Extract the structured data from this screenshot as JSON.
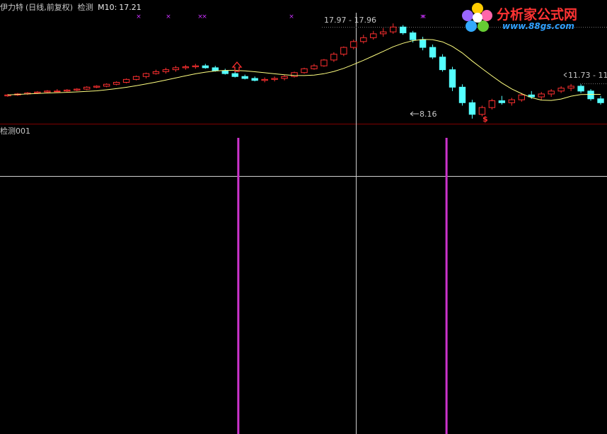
{
  "header": {
    "stock_name": "伊力特",
    "period": "(日线,前复权)",
    "indicator": "检测",
    "ma_label": "M10:",
    "ma_value": "17.21"
  },
  "logo": {
    "name": "分析家公式网",
    "url": "www.88gs.com"
  },
  "annotations": {
    "high_price_label": "17.97 - 17.96",
    "low_price_label": "8.16",
    "right_price_label": "11.73 - 11",
    "signal_marker": "$"
  },
  "sub_panel": {
    "label": "检测001"
  },
  "colors": {
    "up_candle": "#ff3030",
    "down_candle": "#54ffff",
    "ma_line": "#ffff80",
    "signal_bar": "#cc33cc",
    "cross_marker": "#cc33ff",
    "arrow_marker": "#ff3030",
    "crosshair": "#d0d0d0",
    "divider": "#800000"
  },
  "chart_data": {
    "type": "candlestick",
    "series": [
      {
        "values": [
          [
            10.5,
            10.7,
            10.4,
            10.6
          ],
          [
            10.6,
            10.8,
            10.5,
            10.7
          ],
          [
            10.7,
            10.9,
            10.6,
            10.8
          ],
          [
            10.8,
            11.0,
            10.7,
            10.9
          ],
          [
            10.9,
            11.1,
            10.8,
            11.0
          ],
          [
            11.0,
            11.2,
            10.9,
            11.0
          ],
          [
            11.0,
            11.2,
            10.9,
            11.1
          ],
          [
            11.1,
            11.3,
            11.0,
            11.2
          ],
          [
            11.2,
            11.5,
            11.1,
            11.4
          ],
          [
            11.4,
            11.6,
            11.3,
            11.5
          ],
          [
            11.5,
            11.8,
            11.4,
            11.7
          ],
          [
            11.7,
            12.0,
            11.6,
            11.9
          ],
          [
            11.9,
            12.3,
            11.8,
            12.2
          ],
          [
            12.2,
            12.6,
            12.1,
            12.5
          ],
          [
            12.5,
            12.9,
            12.3,
            12.8
          ],
          [
            12.8,
            13.2,
            12.7,
            13.0
          ],
          [
            13.0,
            13.4,
            12.8,
            13.2
          ],
          [
            13.2,
            13.6,
            13.0,
            13.4
          ],
          [
            13.4,
            13.7,
            13.2,
            13.5
          ],
          [
            13.5,
            13.8,
            13.3,
            13.6
          ],
          [
            13.6,
            13.8,
            13.3,
            13.4
          ],
          [
            13.4,
            13.6,
            13.0,
            13.1
          ],
          [
            13.1,
            13.3,
            12.7,
            12.8
          ],
          [
            12.8,
            13.0,
            12.4,
            12.5
          ],
          [
            12.5,
            12.7,
            12.2,
            12.3
          ],
          [
            12.3,
            12.5,
            12.0,
            12.1
          ],
          [
            12.1,
            12.4,
            11.9,
            12.2
          ],
          [
            12.2,
            12.5,
            12.0,
            12.3
          ],
          [
            12.3,
            12.7,
            12.1,
            12.5
          ],
          [
            12.5,
            13.0,
            12.4,
            12.9
          ],
          [
            12.9,
            13.4,
            12.8,
            13.3
          ],
          [
            13.3,
            13.8,
            13.2,
            13.6
          ],
          [
            13.6,
            14.3,
            13.5,
            14.2
          ],
          [
            14.2,
            15.0,
            14.0,
            14.8
          ],
          [
            14.8,
            15.6,
            14.6,
            15.5
          ],
          [
            15.5,
            16.3,
            15.3,
            16.1
          ],
          [
            16.1,
            16.8,
            15.9,
            16.5
          ],
          [
            16.5,
            17.2,
            16.3,
            16.9
          ],
          [
            16.9,
            17.5,
            16.6,
            17.1
          ],
          [
            17.1,
            17.97,
            16.9,
            17.6
          ],
          [
            17.6,
            17.8,
            16.8,
            17.0
          ],
          [
            17.0,
            17.2,
            16.0,
            16.3
          ],
          [
            16.3,
            16.6,
            15.2,
            15.5
          ],
          [
            15.5,
            15.8,
            14.3,
            14.5
          ],
          [
            14.5,
            14.8,
            13.0,
            13.2
          ],
          [
            13.2,
            13.5,
            11.0,
            11.4
          ],
          [
            11.4,
            11.7,
            9.5,
            9.8
          ],
          [
            9.8,
            10.1,
            8.16,
            8.6
          ],
          [
            8.6,
            9.5,
            8.4,
            9.3
          ],
          [
            9.3,
            10.2,
            9.1,
            10.0
          ],
          [
            10.0,
            10.5,
            9.6,
            9.8
          ],
          [
            9.8,
            10.3,
            9.5,
            10.1
          ],
          [
            10.1,
            10.8,
            9.9,
            10.6
          ],
          [
            10.6,
            11.0,
            10.2,
            10.4
          ],
          [
            10.4,
            10.9,
            10.1,
            10.7
          ],
          [
            10.7,
            11.2,
            10.4,
            11.0
          ],
          [
            11.0,
            11.5,
            10.8,
            11.3
          ],
          [
            11.3,
            11.73,
            11.0,
            11.5
          ],
          [
            11.5,
            11.7,
            10.8,
            11.0
          ],
          [
            11.0,
            11.2,
            10.0,
            10.2
          ],
          [
            10.2,
            10.5,
            9.6,
            9.8
          ]
        ]
      }
    ],
    "annotations": [
      "17.97 - 17.96",
      "8.16",
      "11.73 - 11"
    ],
    "ma_label": "M10",
    "ma_value": 17.21,
    "signal_positions": [
      0.392,
      0.735
    ]
  }
}
